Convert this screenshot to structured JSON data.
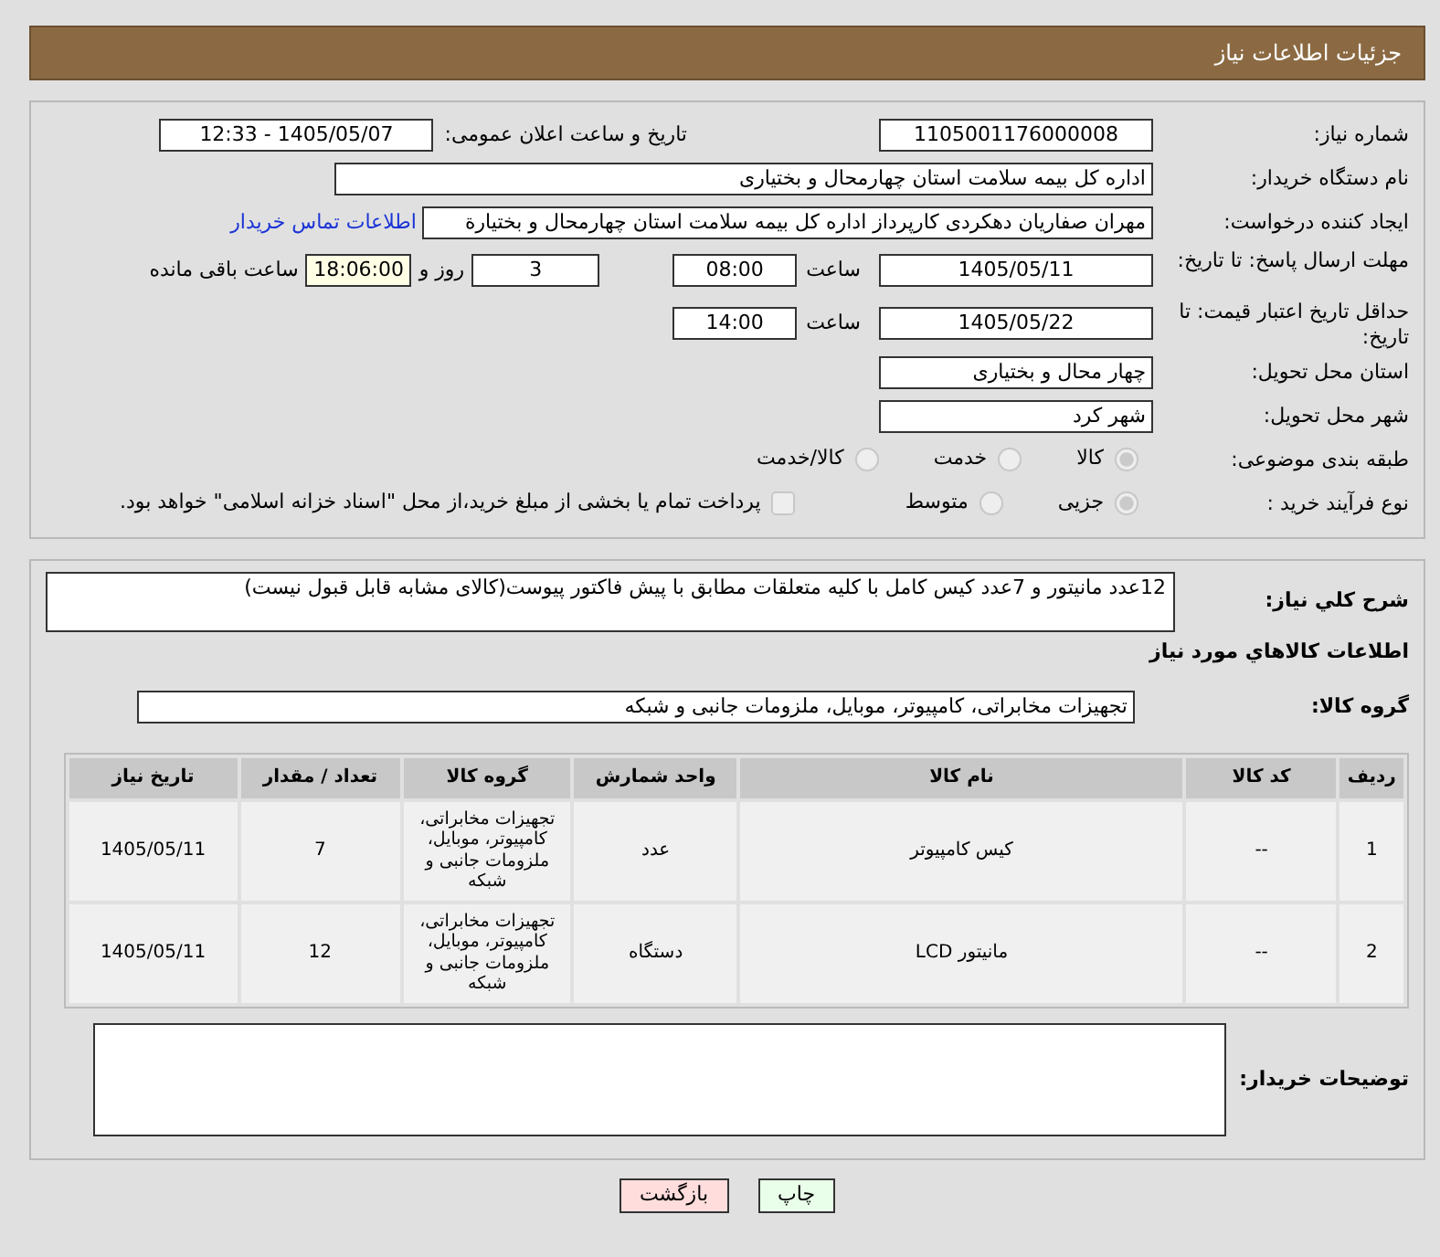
{
  "header": {
    "title": "جزئیات اطلاعات نیاز"
  },
  "need_number": {
    "label": "شماره نیاز:",
    "value": "1105001176000008"
  },
  "announce": {
    "label": "تاریخ و ساعت اعلان عمومی:",
    "value": "1405/05/07 - 12:33"
  },
  "buyer_org": {
    "label": "نام دستگاه خریدار:",
    "value": "اداره کل بیمه سلامت استان چهارمحال و بختیاری"
  },
  "requester": {
    "label": "ایجاد کننده درخواست:",
    "value": "مهران صفاریان دهکردی کارپرداز اداره کل بیمه سلامت استان چهارمحال و بختیارة",
    "link": "اطلاعات تماس خریدار"
  },
  "reply_deadline": {
    "label": "مهلت ارسال پاسخ: تا تاریخ:",
    "date": "1405/05/11",
    "time_label": "ساعت",
    "time": "08:00",
    "days": "3",
    "days_label": "روز و",
    "remaining": "18:06:00",
    "remaining_label": "ساعت باقی مانده"
  },
  "price_validity": {
    "label": "حداقل تاریخ اعتبار قیمت: تا تاریخ:",
    "date": "1405/05/22",
    "time_label": "ساعت",
    "time": "14:00"
  },
  "province": {
    "label": "استان محل تحویل:",
    "value": "چهار محال و بختیاری"
  },
  "city": {
    "label": "شهر محل تحویل:",
    "value": "شهر کرد"
  },
  "category": {
    "label": "طبقه بندی موضوعی:",
    "options": [
      {
        "label": "کالا",
        "selected": true
      },
      {
        "label": "خدمت",
        "selected": false
      },
      {
        "label": "کالا/خدمت",
        "selected": false
      }
    ]
  },
  "process": {
    "label": "نوع فرآیند خرید :",
    "options": [
      {
        "label": "جزیی",
        "selected": true
      },
      {
        "label": "متوسط",
        "selected": false
      }
    ],
    "payment": {
      "label": "پرداخت تمام یا بخشی از مبلغ خرید،از محل \"اسناد خزانه اسلامی\" خواهد بود.",
      "checked": false
    }
  },
  "description": {
    "label": "شرح کلي نیاز:",
    "value": "12عدد مانیتور و 7عدد کیس کامل با کلیه متعلقات مطابق با پیش فاکتور پیوست(کالای مشابه قابل قبول نیست)"
  },
  "goods_title": "اطلاعات کالاهاي مورد نیاز",
  "goods_group": {
    "label": "گروه کالا:",
    "value": "تجهیزات مخابراتی، کامپیوتر، موبایل، ملزومات جانبی و شبکه"
  },
  "table": {
    "columns": [
      "ردیف",
      "کد کالا",
      "نام کالا",
      "واحد شمارش",
      "گروه کالا",
      "تعداد / مقدار",
      "تاریخ نیاز"
    ],
    "rows": [
      [
        "1",
        "--",
        "کیس کامپیوتر",
        "عدد",
        "تجهیزات مخابراتی، کامپیوتر، موبایل، ملزومات جانبی و شبکه",
        "7",
        "1405/05/11"
      ],
      [
        "2",
        "--",
        "مانیتور LCD",
        "دستگاه",
        "تجهیزات مخابراتی، کامپیوتر، موبایل، ملزومات جانبی و شبکه",
        "12",
        "1405/05/11"
      ]
    ]
  },
  "buyer_notes": {
    "label": "توضیحات خریدار:"
  },
  "buttons": [
    {
      "label": "چاپ",
      "kind": "print"
    },
    {
      "label": "بازگشت",
      "kind": "back"
    }
  ]
}
